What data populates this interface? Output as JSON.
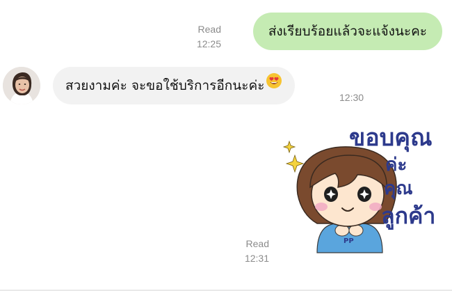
{
  "messages": {
    "outgoing_1": {
      "text": "ส่งเรียบร้อยแล้วจะแจ้งนะคะ",
      "status": "Read",
      "time": "12:25"
    },
    "incoming_1": {
      "text": "สวยงามค่ะ จะขอใช้บริการอีกนะค่ะ",
      "emoji": "heart-eyes-emoji",
      "time": "12:30"
    },
    "sticker_1": {
      "caption_lines": [
        "ขอบคุณ",
        "ค่ะ",
        "คุณ",
        "ลูกค้า"
      ],
      "shirt_text": "PP",
      "status": "Read",
      "time": "12:31"
    }
  },
  "colors": {
    "outgoing_bubble": "#c5ebb3",
    "incoming_bubble": "#f2f2f2",
    "meta_text": "#8b8b8b",
    "sticker_text": "#2d3a8c"
  }
}
